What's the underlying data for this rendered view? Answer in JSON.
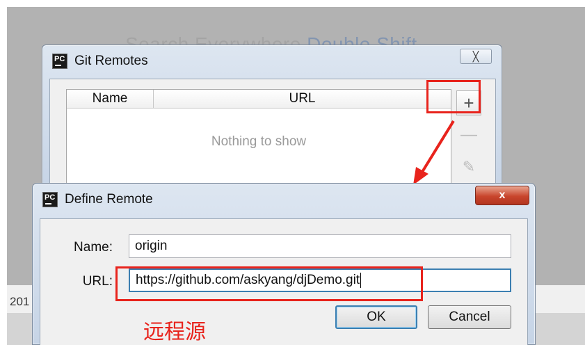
{
  "ide": {
    "search_hint": "Search Everywhere",
    "search_hint_key": "Double Shift",
    "footer_year": "201"
  },
  "git_remotes": {
    "title": "Git Remotes",
    "close_label": "╳",
    "icon_text": "PC",
    "table": {
      "columns": [
        "Name",
        "URL"
      ],
      "empty_text": "Nothing to show"
    },
    "toolbar": {
      "add": "+",
      "remove": "—",
      "edit": "✎"
    }
  },
  "define_remote": {
    "title": "Define Remote",
    "icon_text": "PC",
    "close_label": "x",
    "name_label": "Name:",
    "name_value": "origin",
    "url_label": "URL:",
    "url_value": "https://github.com/askyang/djDemo.git",
    "ok_label": "OK",
    "cancel_label": "Cancel"
  },
  "annotations": {
    "remote_caption": "远程源",
    "color": "#e8231c"
  }
}
